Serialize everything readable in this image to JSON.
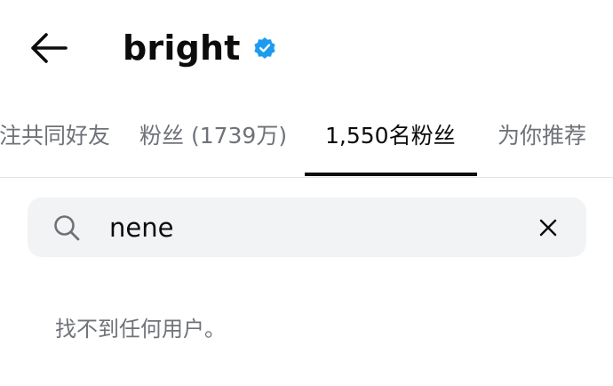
{
  "header": {
    "title": "bright",
    "back_icon": "arrow-left-icon",
    "verified_icon": "verified-badge-icon",
    "verified_color": "#1d9bf0"
  },
  "tabs": [
    {
      "label": "关注共同好友",
      "active": false
    },
    {
      "label": "粉丝 (1739万)",
      "active": false
    },
    {
      "label": "1,550名粉丝",
      "active": true
    },
    {
      "label": "为你推荐",
      "active": false
    }
  ],
  "search": {
    "value": "nene",
    "search_icon": "search-icon",
    "clear_icon": "close-icon"
  },
  "results": {
    "empty_message": "找不到任何用户。"
  }
}
